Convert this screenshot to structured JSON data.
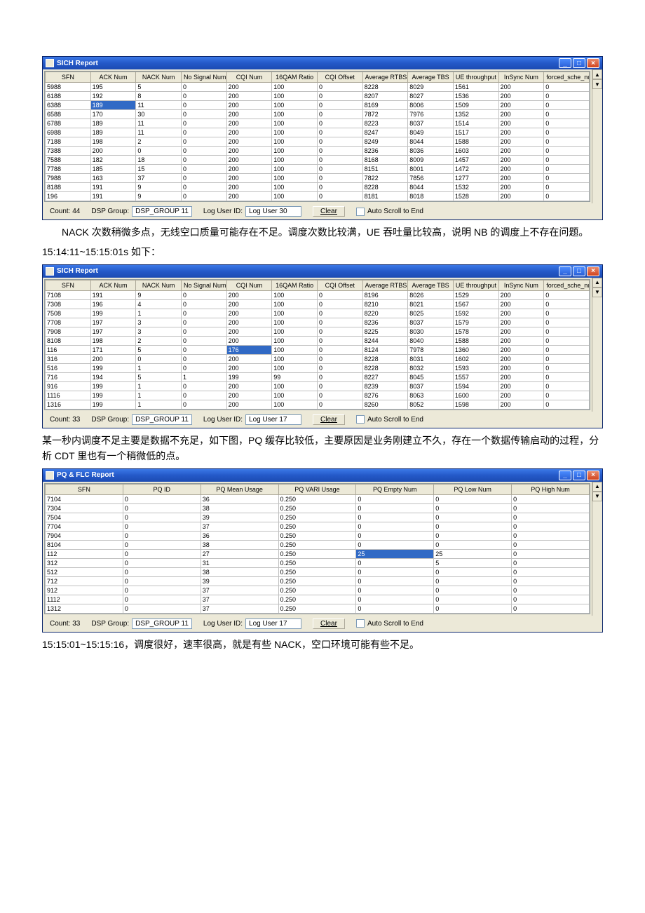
{
  "sich1": {
    "title": "SICH Report",
    "headers": [
      "SFN",
      "ACK Num",
      "NACK Num",
      "No Signal Num",
      "CQI Num",
      "16QAM Ratio",
      "CQI Offset",
      "Average RTBS",
      "Average TBS",
      "UE throughput",
      "InSync Num",
      "forced_sche_num"
    ],
    "rows": [
      [
        "5988",
        "195",
        "5",
        "0",
        "200",
        "100",
        "0",
        "8228",
        "8029",
        "1561",
        "200",
        "0"
      ],
      [
        "6188",
        "192",
        "8",
        "0",
        "200",
        "100",
        "0",
        "8207",
        "8027",
        "1536",
        "200",
        "0"
      ],
      [
        "6388",
        "189",
        "11",
        "0",
        "200",
        "100",
        "0",
        "8169",
        "8006",
        "1509",
        "200",
        "0"
      ],
      [
        "6588",
        "170",
        "30",
        "0",
        "200",
        "100",
        "0",
        "7872",
        "7976",
        "1352",
        "200",
        "0"
      ],
      [
        "6788",
        "189",
        "11",
        "0",
        "200",
        "100",
        "0",
        "8223",
        "8037",
        "1514",
        "200",
        "0"
      ],
      [
        "6988",
        "189",
        "11",
        "0",
        "200",
        "100",
        "0",
        "8247",
        "8049",
        "1517",
        "200",
        "0"
      ],
      [
        "7188",
        "198",
        "2",
        "0",
        "200",
        "100",
        "0",
        "8249",
        "8044",
        "1588",
        "200",
        "0"
      ],
      [
        "7388",
        "200",
        "0",
        "0",
        "200",
        "100",
        "0",
        "8236",
        "8036",
        "1603",
        "200",
        "0"
      ],
      [
        "7588",
        "182",
        "18",
        "0",
        "200",
        "100",
        "0",
        "8168",
        "8009",
        "1457",
        "200",
        "0"
      ],
      [
        "7788",
        "185",
        "15",
        "0",
        "200",
        "100",
        "0",
        "8151",
        "8001",
        "1472",
        "200",
        "0"
      ],
      [
        "7988",
        "163",
        "37",
        "0",
        "200",
        "100",
        "0",
        "7822",
        "7856",
        "1277",
        "200",
        "0"
      ],
      [
        "8188",
        "191",
        "9",
        "0",
        "200",
        "100",
        "0",
        "8228",
        "8044",
        "1532",
        "200",
        "0"
      ],
      [
        "196",
        "191",
        "9",
        "0",
        "200",
        "100",
        "0",
        "8181",
        "8018",
        "1528",
        "200",
        "0"
      ]
    ],
    "selected_cell": {
      "row": 2,
      "col": 1
    },
    "status": {
      "count_label": "Count: 44",
      "dsp_label": "DSP Group:",
      "dsp_value": "DSP_GROUP 11",
      "loguser_label": "Log User ID:",
      "loguser_value": "Log User 30",
      "clear": "Clear",
      "autoscroll": "Auto Scroll to End"
    }
  },
  "para1": "NACK 次数稍微多点，无线空口质量可能存在不足。调度次数比较满，UE 吞吐量比较高，说明 NB 的调度上不存在问题。",
  "para1b": "15:14:11~15:15:01s 如下：",
  "sich2": {
    "title": "SICH Report",
    "headers": [
      "SFN",
      "ACK Num",
      "NACK Num",
      "No Signal Num",
      "CQI Num",
      "16QAM Ratio",
      "CQI Offset",
      "Average RTBS",
      "Average TBS",
      "UE throughput",
      "InSync Num",
      "forced_sche_num"
    ],
    "rows": [
      [
        "7108",
        "191",
        "9",
        "0",
        "200",
        "100",
        "0",
        "8196",
        "8026",
        "1529",
        "200",
        "0"
      ],
      [
        "7308",
        "196",
        "4",
        "0",
        "200",
        "100",
        "0",
        "8210",
        "8021",
        "1567",
        "200",
        "0"
      ],
      [
        "7508",
        "199",
        "1",
        "0",
        "200",
        "100",
        "0",
        "8220",
        "8025",
        "1592",
        "200",
        "0"
      ],
      [
        "7708",
        "197",
        "3",
        "0",
        "200",
        "100",
        "0",
        "8236",
        "8037",
        "1579",
        "200",
        "0"
      ],
      [
        "7908",
        "197",
        "3",
        "0",
        "200",
        "100",
        "0",
        "8225",
        "8030",
        "1578",
        "200",
        "0"
      ],
      [
        "8108",
        "198",
        "2",
        "0",
        "200",
        "100",
        "0",
        "8244",
        "8040",
        "1588",
        "200",
        "0"
      ],
      [
        "116",
        "171",
        "5",
        "0",
        "176",
        "100",
        "0",
        "8124",
        "7978",
        "1360",
        "200",
        "0"
      ],
      [
        "316",
        "200",
        "0",
        "0",
        "200",
        "100",
        "0",
        "8228",
        "8031",
        "1602",
        "200",
        "0"
      ],
      [
        "516",
        "199",
        "1",
        "0",
        "200",
        "100",
        "0",
        "8228",
        "8032",
        "1593",
        "200",
        "0"
      ],
      [
        "716",
        "194",
        "5",
        "1",
        "199",
        "99",
        "0",
        "8227",
        "8045",
        "1557",
        "200",
        "0"
      ],
      [
        "916",
        "199",
        "1",
        "0",
        "200",
        "100",
        "0",
        "8239",
        "8037",
        "1594",
        "200",
        "0"
      ],
      [
        "1116",
        "199",
        "1",
        "0",
        "200",
        "100",
        "0",
        "8276",
        "8063",
        "1600",
        "200",
        "0"
      ],
      [
        "1316",
        "199",
        "1",
        "0",
        "200",
        "100",
        "0",
        "8260",
        "8052",
        "1598",
        "200",
        "0"
      ]
    ],
    "selected_cell": {
      "row": 6,
      "col": 4
    },
    "status": {
      "count_label": "Count: 33",
      "dsp_label": "DSP Group:",
      "dsp_value": "DSP_GROUP 11",
      "loguser_label": "Log User ID:",
      "loguser_value": "Log User 17",
      "clear": "Clear",
      "autoscroll": "Auto Scroll to End"
    }
  },
  "para2": "某一秒内调度不足主要是数据不充足，如下图，PQ 缓存比较低，主要原因是业务刚建立不久，存在一个数据传输启动的过程，分析 CDT 里也有一个稍微低的点。",
  "pq": {
    "title": "PQ & FLC Report",
    "headers": [
      "SFN",
      "PQ ID",
      "PQ Mean Usage",
      "PQ VARI Usage",
      "PQ Empty Num",
      "PQ Low Num",
      "PQ High Num"
    ],
    "rows": [
      [
        "7104",
        "0",
        "36",
        "0.250",
        "0",
        "0",
        "0"
      ],
      [
        "7304",
        "0",
        "38",
        "0.250",
        "0",
        "0",
        "0"
      ],
      [
        "7504",
        "0",
        "39",
        "0.250",
        "0",
        "0",
        "0"
      ],
      [
        "7704",
        "0",
        "37",
        "0.250",
        "0",
        "0",
        "0"
      ],
      [
        "7904",
        "0",
        "36",
        "0.250",
        "0",
        "0",
        "0"
      ],
      [
        "8104",
        "0",
        "38",
        "0.250",
        "0",
        "0",
        "0"
      ],
      [
        "112",
        "0",
        "27",
        "0.250",
        "25",
        "25",
        "0"
      ],
      [
        "312",
        "0",
        "31",
        "0.250",
        "0",
        "5",
        "0"
      ],
      [
        "512",
        "0",
        "38",
        "0.250",
        "0",
        "0",
        "0"
      ],
      [
        "712",
        "0",
        "39",
        "0.250",
        "0",
        "0",
        "0"
      ],
      [
        "912",
        "0",
        "37",
        "0.250",
        "0",
        "0",
        "0"
      ],
      [
        "1112",
        "0",
        "37",
        "0.250",
        "0",
        "0",
        "0"
      ],
      [
        "1312",
        "0",
        "37",
        "0.250",
        "0",
        "0",
        "0"
      ]
    ],
    "selected_cell": {
      "row": 6,
      "col": 4
    },
    "status": {
      "count_label": "Count: 33",
      "dsp_label": "DSP Group:",
      "dsp_value": "DSP_GROUP 11",
      "loguser_label": "Log User ID:",
      "loguser_value": "Log User 17",
      "clear": "Clear",
      "autoscroll": "Auto Scroll to End"
    }
  },
  "para3": "15:15:01~15:15:16，调度很好，速率很高，就是有些 NACK，空口环境可能有些不足。"
}
